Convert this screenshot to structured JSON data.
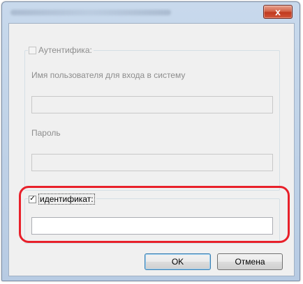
{
  "dialog": {
    "close_symbol": "x"
  },
  "auth_group": {
    "checkbox_label": "Аутентифика:",
    "checkbox_checked": false,
    "username_label": "Имя пользователя для входа в систему",
    "username_value": "",
    "password_label": "Пароль",
    "password_value": ""
  },
  "id_group": {
    "checkbox_label": "идентификат:",
    "checkbox_checked": true,
    "check_mark": "✓",
    "id_value": ""
  },
  "buttons": {
    "ok_label": "OK",
    "cancel_label": "Отмена"
  },
  "colors": {
    "highlight": "#e8202a",
    "disabled_text": "#8d8d8d"
  },
  "icons": {
    "close": "close-icon"
  }
}
